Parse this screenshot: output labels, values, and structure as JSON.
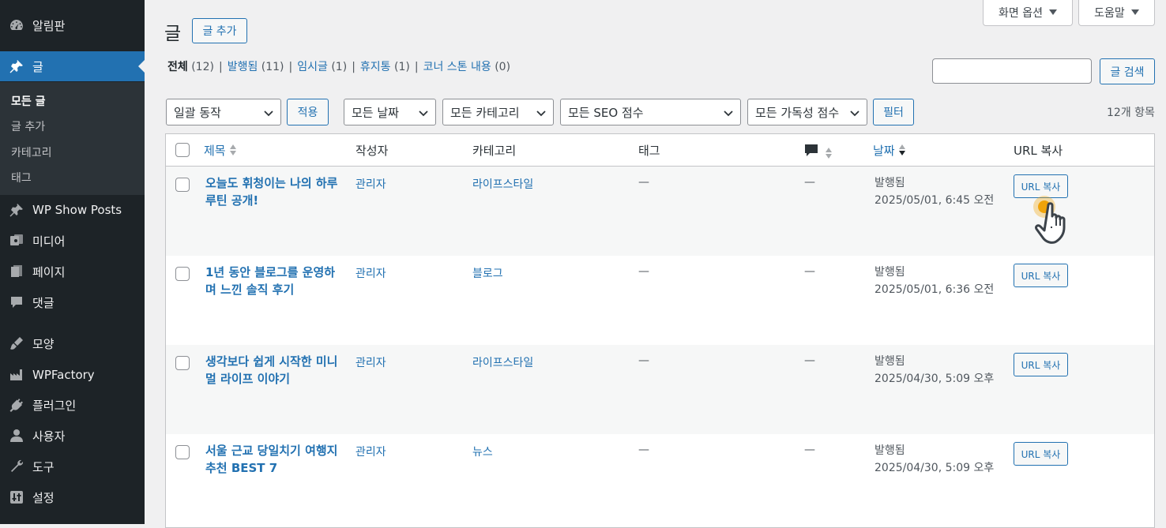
{
  "sidebar": {
    "items": [
      {
        "label": "알림판",
        "icon": "dashboard-icon"
      },
      {
        "label": "글",
        "icon": "pin-icon"
      },
      {
        "label": "WP Show Posts",
        "icon": "pin-icon"
      },
      {
        "label": "미디어",
        "icon": "media-icon"
      },
      {
        "label": "페이지",
        "icon": "page-icon"
      },
      {
        "label": "댓글",
        "icon": "comment-icon"
      },
      {
        "label": "모양",
        "icon": "brush-icon"
      },
      {
        "label": "WPFactory",
        "icon": "factory-icon"
      },
      {
        "label": "플러그인",
        "icon": "plugin-icon"
      },
      {
        "label": "사용자",
        "icon": "user-icon"
      },
      {
        "label": "도구",
        "icon": "wrench-icon"
      },
      {
        "label": "설정",
        "icon": "settings-icon"
      }
    ],
    "submenu": [
      "모든 글",
      "글 추가",
      "카테고리",
      "태그"
    ]
  },
  "header": {
    "title": "글",
    "add_new": "글 추가",
    "screen_options": "화면 옵션",
    "help": "도움말"
  },
  "filters_links": {
    "all": "전체",
    "all_count": "(12)",
    "published": "발행됨",
    "published_count": "(11)",
    "draft": "임시글",
    "draft_count": "(1)",
    "trash": "휴지통",
    "trash_count": "(1)",
    "cornerstone": "코너 스톤 내용",
    "cornerstone_count": "(0)",
    "separator": "|"
  },
  "search": {
    "value": "",
    "button": "글 검색"
  },
  "bulk": {
    "action": "일괄 동작",
    "apply": "적용"
  },
  "filters": {
    "dates": "모든 날짜",
    "categories": "모든 카테고리",
    "seo": "모든 SEO 점수",
    "readability": "모든 가독성 점수",
    "filter_button": "필터"
  },
  "item_count": "12개 항목",
  "table": {
    "columns": {
      "title": "제목",
      "author": "작성자",
      "categories": "카테고리",
      "tags": "태그",
      "date": "날짜",
      "url": "URL 복사"
    },
    "rows": [
      {
        "title": "오늘도 휘청이는 나의 하루 루틴 공개!",
        "author": "관리자",
        "category": "라이프스타일",
        "tags": "—",
        "comments": "—",
        "status": "발행됨",
        "date": "2025/05/01, 6:45 오전",
        "button": "URL 복사"
      },
      {
        "title": "1년 동안 블로그를 운영하며 느낀 솔직 후기",
        "author": "관리자",
        "category": "블로그",
        "tags": "—",
        "comments": "—",
        "status": "발행됨",
        "date": "2025/05/01, 6:36 오전",
        "button": "URL 복사"
      },
      {
        "title": "생각보다 쉽게 시작한 미니멀 라이프 이야기",
        "author": "관리자",
        "category": "라이프스타일",
        "tags": "—",
        "comments": "—",
        "status": "발행됨",
        "date": "2025/04/30, 5:09 오후",
        "button": "URL 복사"
      },
      {
        "title": "서울 근교 당일치기 여행지 추천 BEST 7",
        "author": "관리자",
        "category": "뉴스",
        "tags": "—",
        "comments": "—",
        "status": "발행됨",
        "date": "2025/04/30, 5:09 오후",
        "button": "URL 복사"
      }
    ]
  },
  "colors": {
    "accent": "#2271b1",
    "sidebar": "#1d2327",
    "cursor_highlight": "#f0a30a"
  }
}
